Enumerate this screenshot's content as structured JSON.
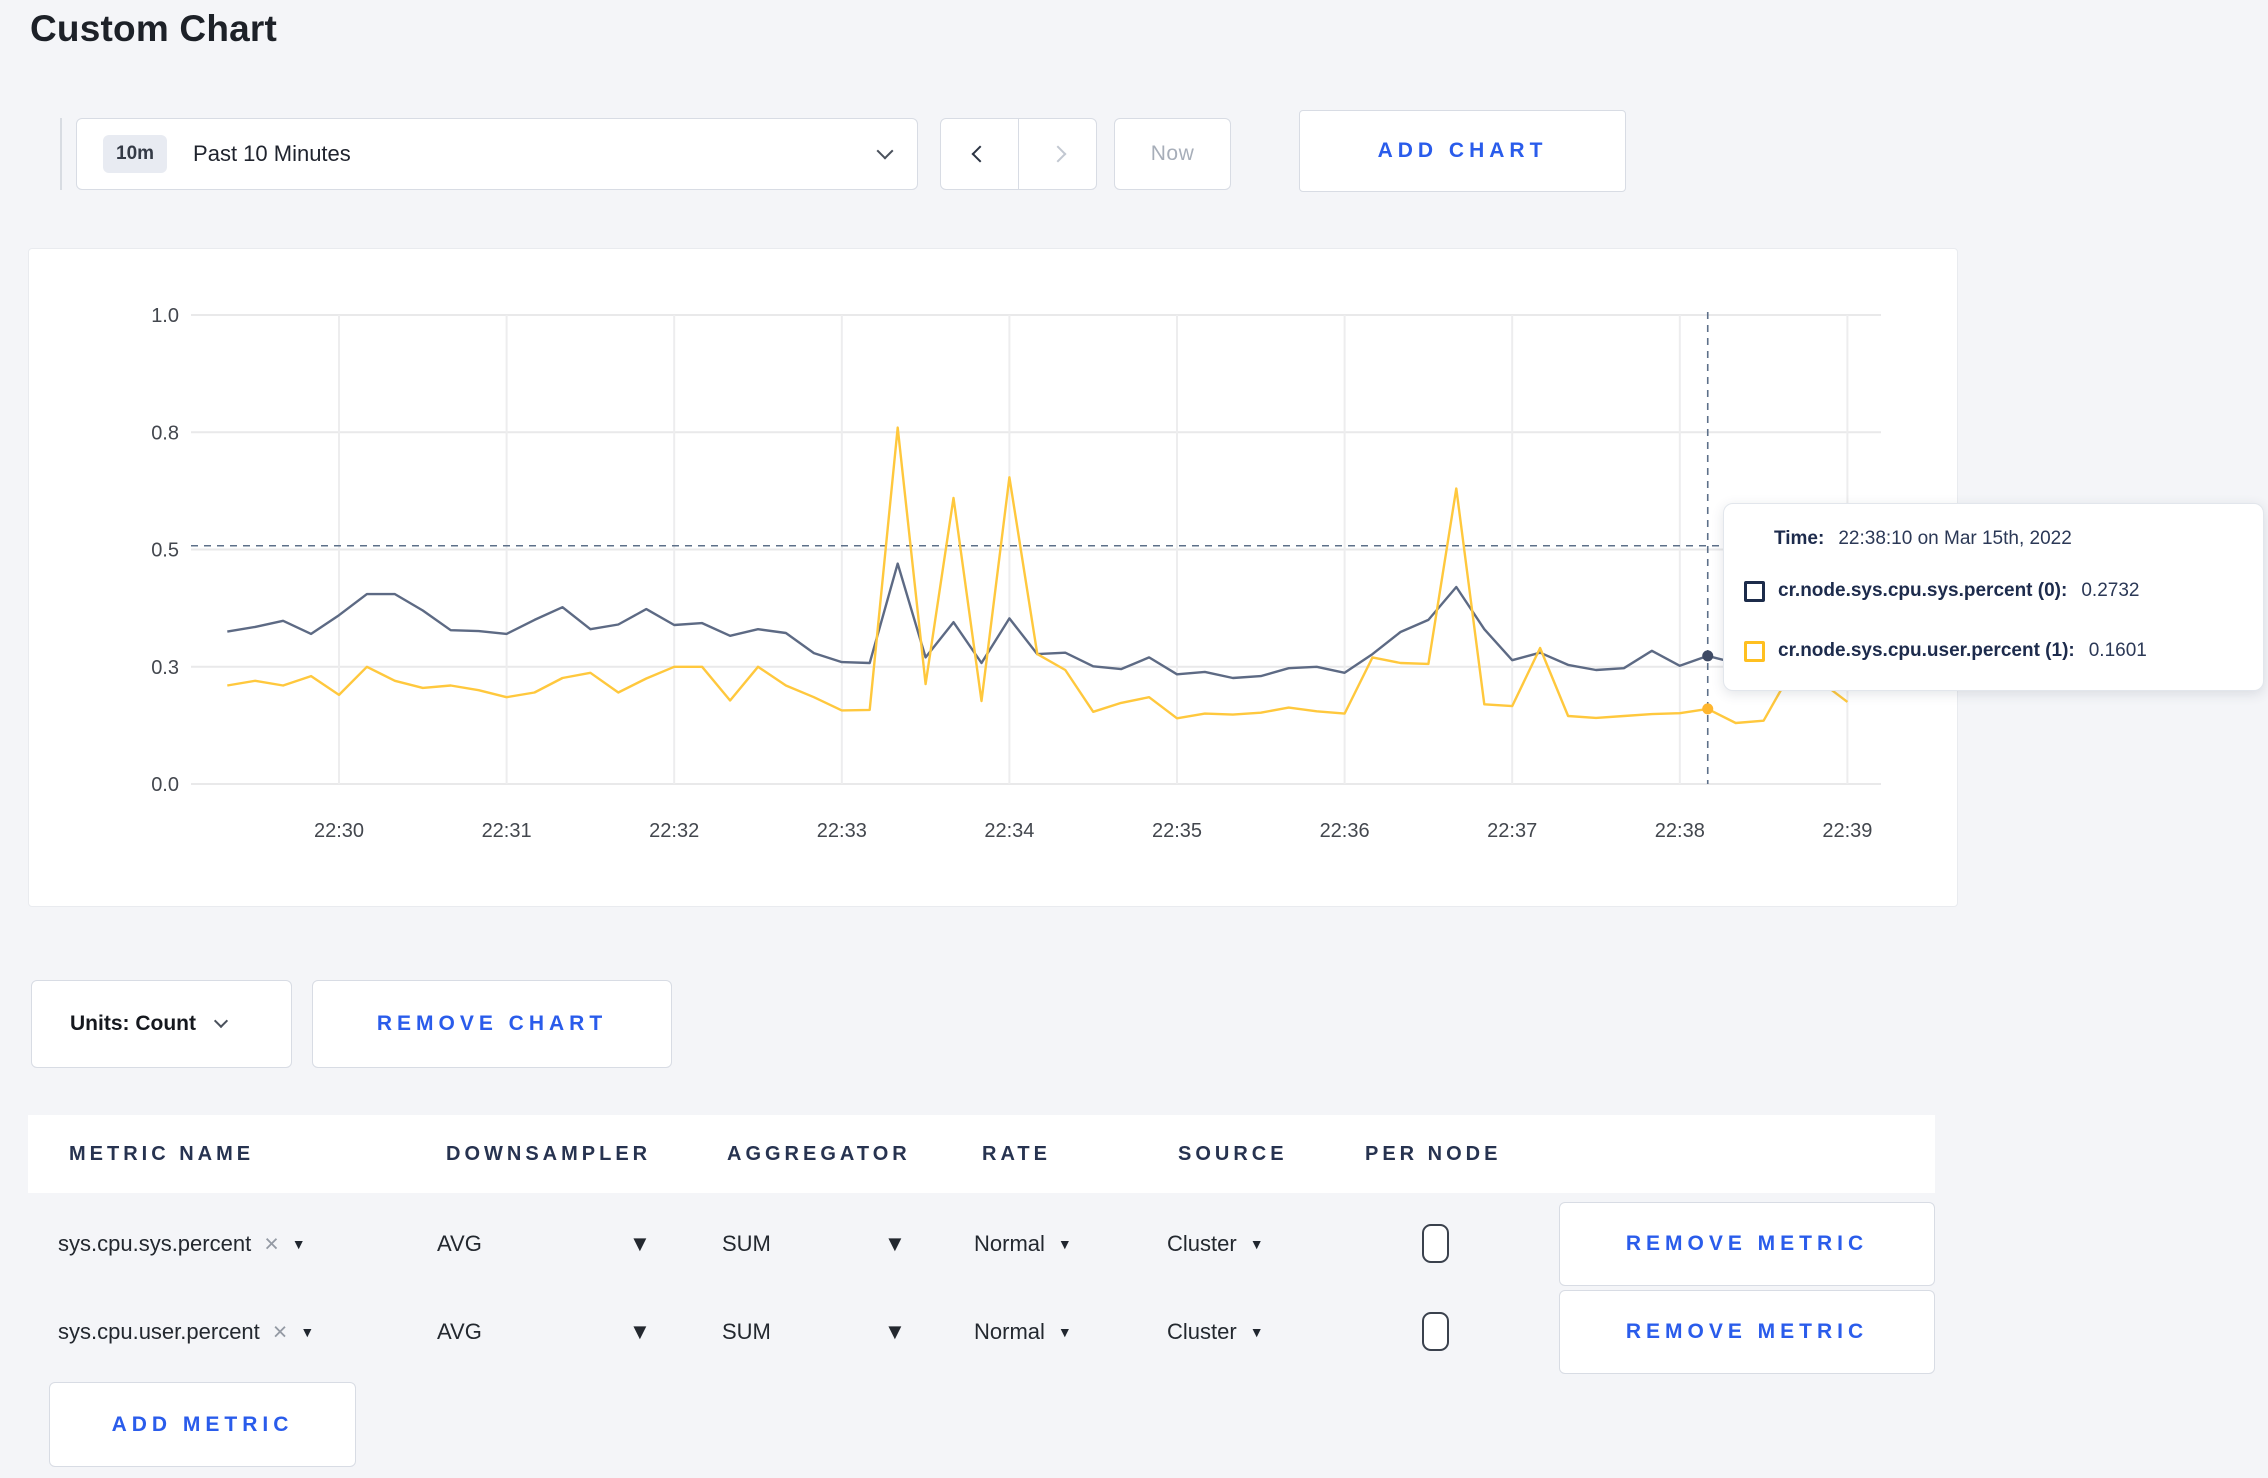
{
  "page": {
    "title": "Custom Chart",
    "accent_blue": "#2a5ceb",
    "background": "#f4f5f8"
  },
  "toolbar": {
    "time_range": {
      "badge": "10m",
      "label": "Past 10 Minutes"
    },
    "now_label": "Now",
    "add_chart_label": "ADD CHART"
  },
  "chart_card": {
    "units_label": "Units: Count",
    "remove_chart_label": "REMOVE CHART",
    "tooltip": {
      "time_label": "Time:",
      "time_value": "22:38:10 on Mar 15th, 2022",
      "entries": [
        {
          "label": "cr.node.sys.cpu.sys.percent (0):",
          "value": "0.2732",
          "swatch": "#1c2b4a"
        },
        {
          "label": "cr.node.sys.cpu.user.percent (1):",
          "value": "0.1601",
          "swatch": "#ffc020"
        }
      ]
    }
  },
  "chart_data": {
    "type": "line",
    "title": "",
    "xlabel": "",
    "ylabel": "",
    "ylim": [
      0,
      1
    ],
    "grid": true,
    "legend": "none",
    "yticks": [
      {
        "value": 1.0,
        "label": "1.0"
      },
      {
        "value": 0.75,
        "label": "0.8"
      },
      {
        "value": 0.5,
        "label": "0.5"
      },
      {
        "value": 0.25,
        "label": "0.3"
      },
      {
        "value": 0.0,
        "label": "0.0"
      }
    ],
    "xticks": [
      "22:30",
      "22:31",
      "22:32",
      "22:33",
      "22:34",
      "22:35",
      "22:36",
      "22:37",
      "22:38",
      "22:39"
    ],
    "x_times": [
      "22:29:20",
      "22:29:30",
      "22:29:40",
      "22:29:50",
      "22:30:00",
      "22:30:10",
      "22:30:20",
      "22:30:30",
      "22:30:40",
      "22:30:50",
      "22:31:00",
      "22:31:10",
      "22:31:20",
      "22:31:30",
      "22:31:40",
      "22:31:50",
      "22:32:00",
      "22:32:10",
      "22:32:20",
      "22:32:30",
      "22:32:40",
      "22:32:50",
      "22:33:00",
      "22:33:10",
      "22:33:20",
      "22:33:30",
      "22:33:40",
      "22:33:50",
      "22:34:00",
      "22:34:10",
      "22:34:20",
      "22:34:30",
      "22:34:40",
      "22:34:50",
      "22:35:00",
      "22:35:10",
      "22:35:20",
      "22:35:30",
      "22:35:40",
      "22:35:50",
      "22:36:00",
      "22:36:10",
      "22:36:20",
      "22:36:30",
      "22:36:40",
      "22:36:50",
      "22:37:00",
      "22:37:10",
      "22:37:20",
      "22:37:30",
      "22:37:40",
      "22:37:50",
      "22:38:00",
      "22:38:10",
      "22:38:20",
      "22:38:30",
      "22:38:40",
      "22:38:50",
      "22:39:00"
    ],
    "series": [
      {
        "name": "cr.node.sys.cpu.sys.percent",
        "color": "#5d6a84",
        "dot_color": "#3e4a64",
        "values": [
          0.325,
          0.335,
          0.348,
          0.32,
          0.36,
          0.405,
          0.405,
          0.37,
          0.328,
          0.326,
          0.32,
          0.35,
          0.377,
          0.33,
          0.34,
          0.373,
          0.339,
          0.343,
          0.316,
          0.33,
          0.322,
          0.279,
          0.26,
          0.258,
          0.47,
          0.27,
          0.345,
          0.258,
          0.353,
          0.277,
          0.28,
          0.251,
          0.245,
          0.27,
          0.234,
          0.239,
          0.226,
          0.23,
          0.247,
          0.25,
          0.237,
          0.277,
          0.324,
          0.35,
          0.42,
          0.33,
          0.264,
          0.28,
          0.254,
          0.243,
          0.247,
          0.284,
          0.252,
          0.2732,
          0.258,
          0.295,
          0.305,
          0.32,
          0.3
        ]
      },
      {
        "name": "cr.node.sys.cpu.user.percent",
        "color": "#ffc83d",
        "dot_color": "#ffb62e",
        "values": [
          0.21,
          0.22,
          0.21,
          0.23,
          0.19,
          0.25,
          0.22,
          0.205,
          0.21,
          0.2,
          0.185,
          0.195,
          0.226,
          0.237,
          0.195,
          0.225,
          0.25,
          0.25,
          0.178,
          0.25,
          0.21,
          0.185,
          0.157,
          0.158,
          0.76,
          0.213,
          0.61,
          0.177,
          0.654,
          0.277,
          0.243,
          0.154,
          0.173,
          0.185,
          0.14,
          0.15,
          0.148,
          0.152,
          0.163,
          0.155,
          0.15,
          0.27,
          0.258,
          0.256,
          0.63,
          0.17,
          0.166,
          0.29,
          0.145,
          0.141,
          0.145,
          0.149,
          0.151,
          0.1601,
          0.13,
          0.135,
          0.24,
          0.22,
          0.175
        ]
      }
    ],
    "crosshair": {
      "time": "22:38:10",
      "y_guide": 0.508,
      "points": [
        0.2732,
        0.1601
      ]
    }
  },
  "metrics_table": {
    "headers": [
      "METRIC NAME",
      "DOWNSAMPLER",
      "AGGREGATOR",
      "RATE",
      "SOURCE",
      "PER NODE"
    ],
    "rows": [
      {
        "metric": "sys.cpu.sys.percent",
        "downsampler": "AVG",
        "aggregator": "SUM",
        "rate": "Normal",
        "source": "Cluster",
        "per_node_checked": false
      },
      {
        "metric": "sys.cpu.user.percent",
        "downsampler": "AVG",
        "aggregator": "SUM",
        "rate": "Normal",
        "source": "Cluster",
        "per_node_checked": false
      }
    ],
    "remove_metric_label": "REMOVE METRIC",
    "add_metric_label": "ADD METRIC"
  }
}
